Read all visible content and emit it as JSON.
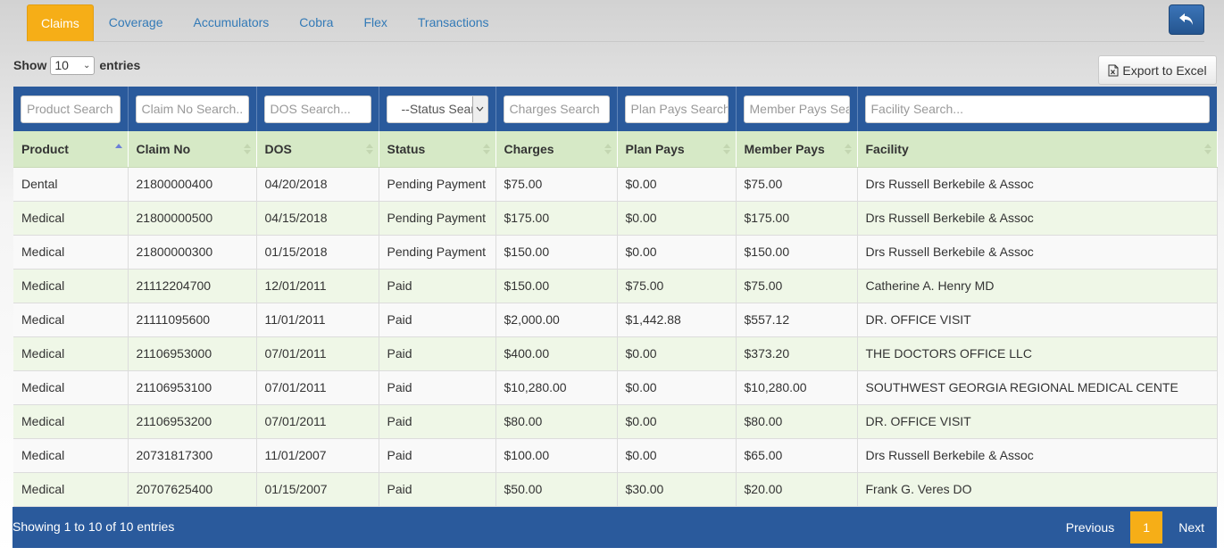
{
  "tabs": [
    {
      "label": "Claims",
      "active": true
    },
    {
      "label": "Coverage"
    },
    {
      "label": "Accumulators"
    },
    {
      "label": "Cobra"
    },
    {
      "label": "Flex"
    },
    {
      "label": "Transactions"
    }
  ],
  "length_control": {
    "prefix": "Show",
    "value": "10",
    "suffix": "entries"
  },
  "export_label": "Export to Excel",
  "filters": {
    "product": "Product Search",
    "claim_no": "Claim No Search..",
    "dos": "DOS Search...",
    "status": "--Status Search--",
    "charges": "Charges Search",
    "plan_pays": "Plan Pays Search",
    "member_pays": "Member Pays Search",
    "facility": "Facility Search..."
  },
  "columns": [
    "Product",
    "Claim No",
    "DOS",
    "Status",
    "Charges",
    "Plan Pays",
    "Member Pays",
    "Facility"
  ],
  "rows": [
    [
      "Dental",
      "21800000400",
      "04/20/2018",
      "Pending Payment",
      "$75.00",
      "$0.00",
      "$75.00",
      "Drs Russell Berkebile & Assoc"
    ],
    [
      "Medical",
      "21800000500",
      "04/15/2018",
      "Pending Payment",
      "$175.00",
      "$0.00",
      "$175.00",
      "Drs Russell Berkebile & Assoc"
    ],
    [
      "Medical",
      "21800000300",
      "01/15/2018",
      "Pending Payment",
      "$150.00",
      "$0.00",
      "$150.00",
      "Drs Russell Berkebile & Assoc"
    ],
    [
      "Medical",
      "21112204700",
      "12/01/2011",
      "Paid",
      "$150.00",
      "$75.00",
      "$75.00",
      "Catherine A. Henry MD"
    ],
    [
      "Medical",
      "21111095600",
      "11/01/2011",
      "Paid",
      "$2,000.00",
      "$1,442.88",
      "$557.12",
      "DR. OFFICE VISIT"
    ],
    [
      "Medical",
      "21106953000",
      "07/01/2011",
      "Paid",
      "$400.00",
      "$0.00",
      "$373.20",
      "THE DOCTORS OFFICE LLC"
    ],
    [
      "Medical",
      "21106953100",
      "07/01/2011",
      "Paid",
      "$10,280.00",
      "$0.00",
      "$10,280.00",
      "SOUTHWEST GEORGIA REGIONAL MEDICAL CENTE"
    ],
    [
      "Medical",
      "21106953200",
      "07/01/2011",
      "Paid",
      "$80.00",
      "$0.00",
      "$80.00",
      "DR. OFFICE VISIT"
    ],
    [
      "Medical",
      "20731817300",
      "11/01/2007",
      "Paid",
      "$100.00",
      "$0.00",
      "$65.00",
      "Drs Russell Berkebile & Assoc"
    ],
    [
      "Medical",
      "20707625400",
      "01/15/2007",
      "Paid",
      "$50.00",
      "$30.00",
      "$20.00",
      "Frank G. Veres DO"
    ]
  ],
  "footer": {
    "info": "Showing 1 to 10 of 10 entries",
    "previous": "Previous",
    "current_page": "1",
    "next": "Next"
  },
  "colors": {
    "accent": "#f6ae17",
    "header_blue": "#2a5a9c",
    "row_green": "#eff7e7",
    "column_head_green": "#d6e9c6"
  },
  "icons": {
    "back": "back-arrow-icon",
    "export": "excel-file-icon",
    "sort": "sort-arrows-icon"
  }
}
